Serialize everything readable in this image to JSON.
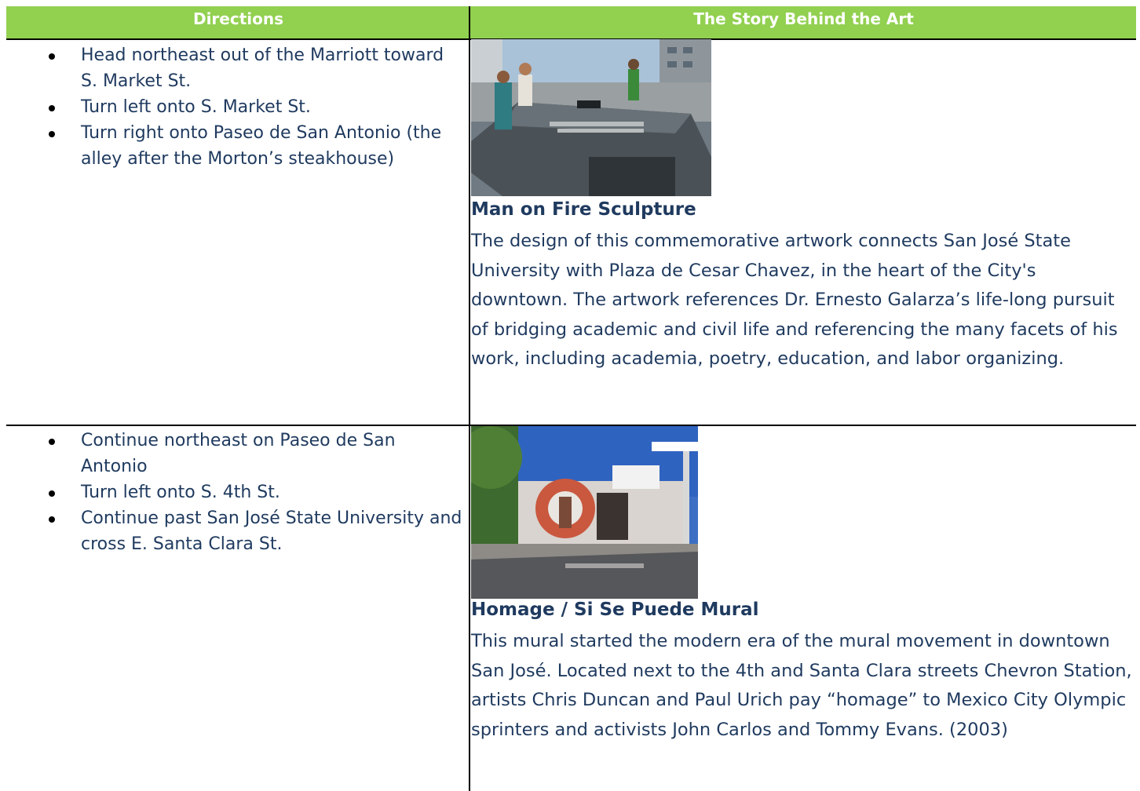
{
  "header": {
    "directions": "Directions",
    "story": "The Story Behind the Art"
  },
  "rows": [
    {
      "steps": [
        "Head northeast out of the Marriott toward S. Market St.",
        "Turn left onto S. Market St.",
        "Turn right onto Paseo de San Antonio (the alley after the Morton’s steakhouse)"
      ],
      "art_title": "Man on Fire Sculpture",
      "art_description": "The design of this commemorative artwork connects San José State University with Plaza de Cesar Chavez, in the heart of the City's downtown. The artwork references Dr. Ernesto Galarza’s life-long pursuit of bridging academic and civil life and referencing the many facets of his work, including academia, poetry, education, and labor organizing."
    },
    {
      "steps": [
        "Continue northeast on Paseo de San Antonio",
        "Turn left onto S. 4th St.",
        "Continue past San José State University and cross E. Santa Clara St."
      ],
      "art_title": "Homage / Si Se Puede Mural",
      "art_description": "This mural started the modern era of the mural movement in downtown San José. Located next to the 4th and Santa Clara streets Chevron Station, artists Chris Duncan and Paul Urich pay “homage” to Mexico City Olympic sprinters and activists John Carlos and Tommy Evans. (2003)"
    }
  ]
}
